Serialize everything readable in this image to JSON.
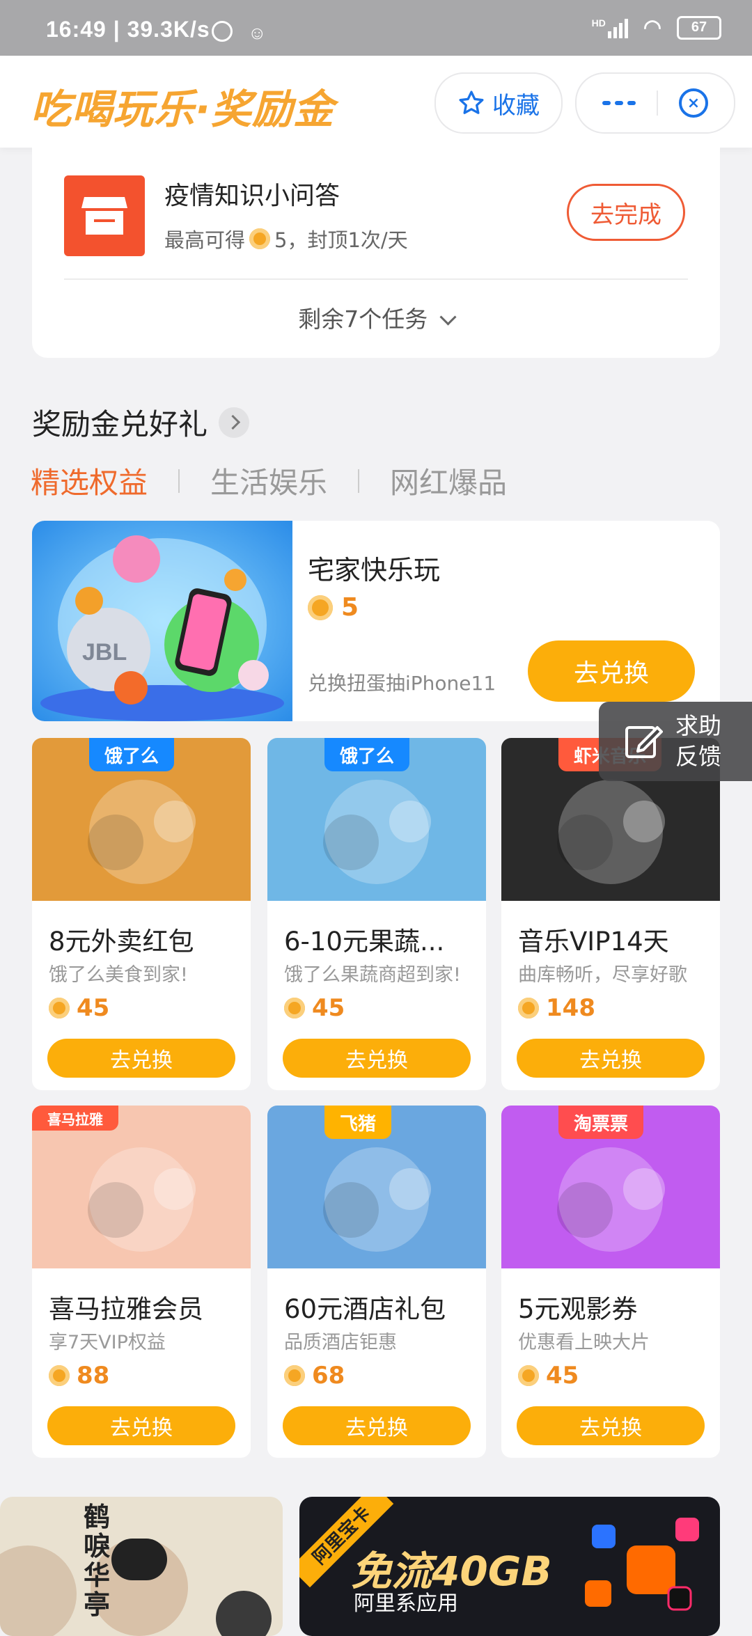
{
  "status_bar": {
    "time": "16:49 | 39.3K/s",
    "battery": "67",
    "net_label": "HD"
  },
  "header": {
    "brand": "吃喝玩乐·奖励金",
    "collect_label": "收藏"
  },
  "task": {
    "title": "疫情知识小问答",
    "sub_prefix": "最高可得",
    "sub_suffix": "5，封顶1次/天",
    "button": "去完成",
    "remaining": "剩余7个任务"
  },
  "section": {
    "title": "奖励金兑好礼",
    "tabs": [
      "精选权益",
      "生活娱乐",
      "网红爆品"
    ]
  },
  "featured": {
    "title": "宅家快乐玩",
    "price": "5",
    "desc": "兑换扭蛋抽iPhone11",
    "button": "去兑换",
    "img_text": "JBL"
  },
  "help": {
    "line1": "求助",
    "line2": "反馈"
  },
  "cards": [
    {
      "tag": "饿了么",
      "name": "8元外卖红包",
      "desc": "饿了么美食到家!",
      "price": "45",
      "button": "去兑换",
      "color": "#e29a3a"
    },
    {
      "tag": "饿了么",
      "name": "6-10元果蔬...",
      "desc": "饿了么果蔬商超到家!",
      "price": "45",
      "button": "去兑换",
      "color": "#6fb7e6"
    },
    {
      "tag": "虾米音乐",
      "name": "音乐VIP14天",
      "desc": "曲库畅听，尽享好歌",
      "price": "148",
      "button": "去兑换",
      "color": "#2a2a2a"
    },
    {
      "tag": "喜马拉雅",
      "name": "喜马拉雅会员",
      "desc": "享7天VIP权益",
      "price": "88",
      "button": "去兑换",
      "color": "#f7c6b0"
    },
    {
      "tag": "飞猪",
      "name": "60元酒店礼包",
      "desc": "品质酒店钜惠",
      "price": "68",
      "button": "去兑换",
      "color": "#6aa7e0"
    },
    {
      "tag": "淘票票",
      "name": "5元观影券",
      "desc": "优惠看上映大片",
      "price": "45",
      "button": "去兑换",
      "color": "#c15cf0"
    }
  ],
  "banners": {
    "left_title": "鹤唳华亭",
    "right_corner": "阿里宝卡",
    "right_title": "免流40GB",
    "right_sub": "阿里系应用"
  }
}
